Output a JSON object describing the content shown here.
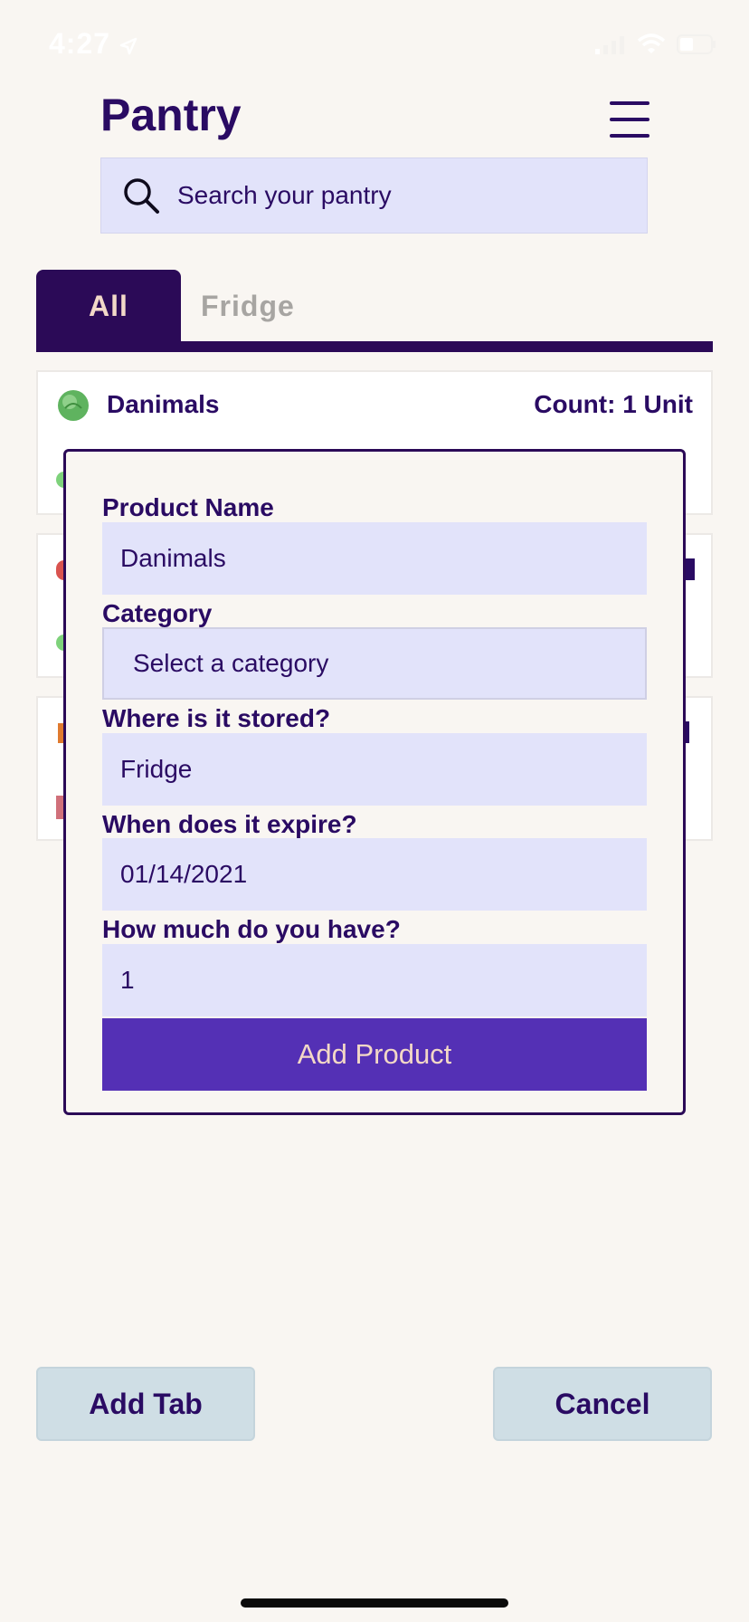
{
  "status_bar": {
    "time": "4:27"
  },
  "header": {
    "title": "Pantry"
  },
  "search": {
    "placeholder": "Search your pantry"
  },
  "tabs": [
    {
      "label": "All",
      "active": true
    },
    {
      "label": "Fridge",
      "active": false
    }
  ],
  "list": {
    "items": [
      {
        "name": "Danimals",
        "count": "Count: 1 Unit"
      }
    ]
  },
  "modal": {
    "product_name_label": "Product Name",
    "product_name_value": "Danimals",
    "category_label": "Category",
    "category_value": "Select a category",
    "storage_label": "Where is it stored?",
    "storage_value": "Fridge",
    "expire_label": "When does it expire?",
    "expire_value": "01/14/2021",
    "amount_label": "How much do you have?",
    "amount_value": "1",
    "submit_label": "Add Product"
  },
  "footer": {
    "add_tab_label": "Add Tab",
    "cancel_label": "Cancel"
  },
  "colors": {
    "primary_dark": "#2b0a57",
    "accent_purple": "#5430b5",
    "input_bg": "#e2e3fa",
    "page_bg": "#f9f6f2"
  }
}
